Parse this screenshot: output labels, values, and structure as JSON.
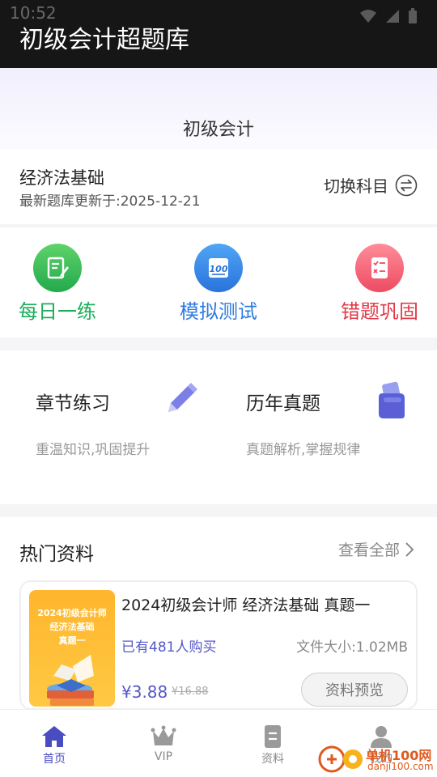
{
  "status_bar": {
    "time": "10:52"
  },
  "app": {
    "title": "初级会计超题库"
  },
  "subject": {
    "name": "初级会计"
  },
  "course": {
    "name": "经济法基础",
    "updated": "最新题库更新于:2025-12-21",
    "switch_label": "切换科目"
  },
  "quick_actions": [
    {
      "label": "每日一练",
      "color": "#1aad5a",
      "icon": "notebook-pen-icon"
    },
    {
      "label": "模拟测试",
      "color": "#2f7be0",
      "icon": "score-100-icon"
    },
    {
      "label": "错题巩固",
      "color": "#e03b4a",
      "icon": "checklist-icon"
    }
  ],
  "practice": [
    {
      "title": "章节练习",
      "desc": "重温知识,巩固提升",
      "icon": "pencil-icon"
    },
    {
      "title": "历年真题",
      "desc": "真题解析,掌握规律",
      "icon": "hand-book-icon"
    }
  ],
  "hot": {
    "title": "热门资料",
    "view_all": "查看全部",
    "items": [
      {
        "cover_lines": [
          "2024初级会计师",
          "经济法基础",
          "真题一"
        ],
        "title": "2024初级会计师 经济法基础 真题一",
        "sold": "已有481人购买",
        "size": "文件大小:1.02MB",
        "price": "¥3.88",
        "original_price": "¥16.88",
        "preview_label": "资料预览"
      }
    ]
  },
  "bottom_nav": [
    {
      "label": "首页",
      "icon": "home-icon",
      "active": true
    },
    {
      "label": "VIP",
      "icon": "crown-icon",
      "active": false
    },
    {
      "label": "资料",
      "icon": "document-icon",
      "active": false
    },
    {
      "label": "我的",
      "icon": "person-icon",
      "active": false
    }
  ],
  "watermark": {
    "name": "单机100网",
    "url": "danji100.com"
  },
  "colors": {
    "accent": "#4a4dc0",
    "header_bg": "#161616"
  }
}
